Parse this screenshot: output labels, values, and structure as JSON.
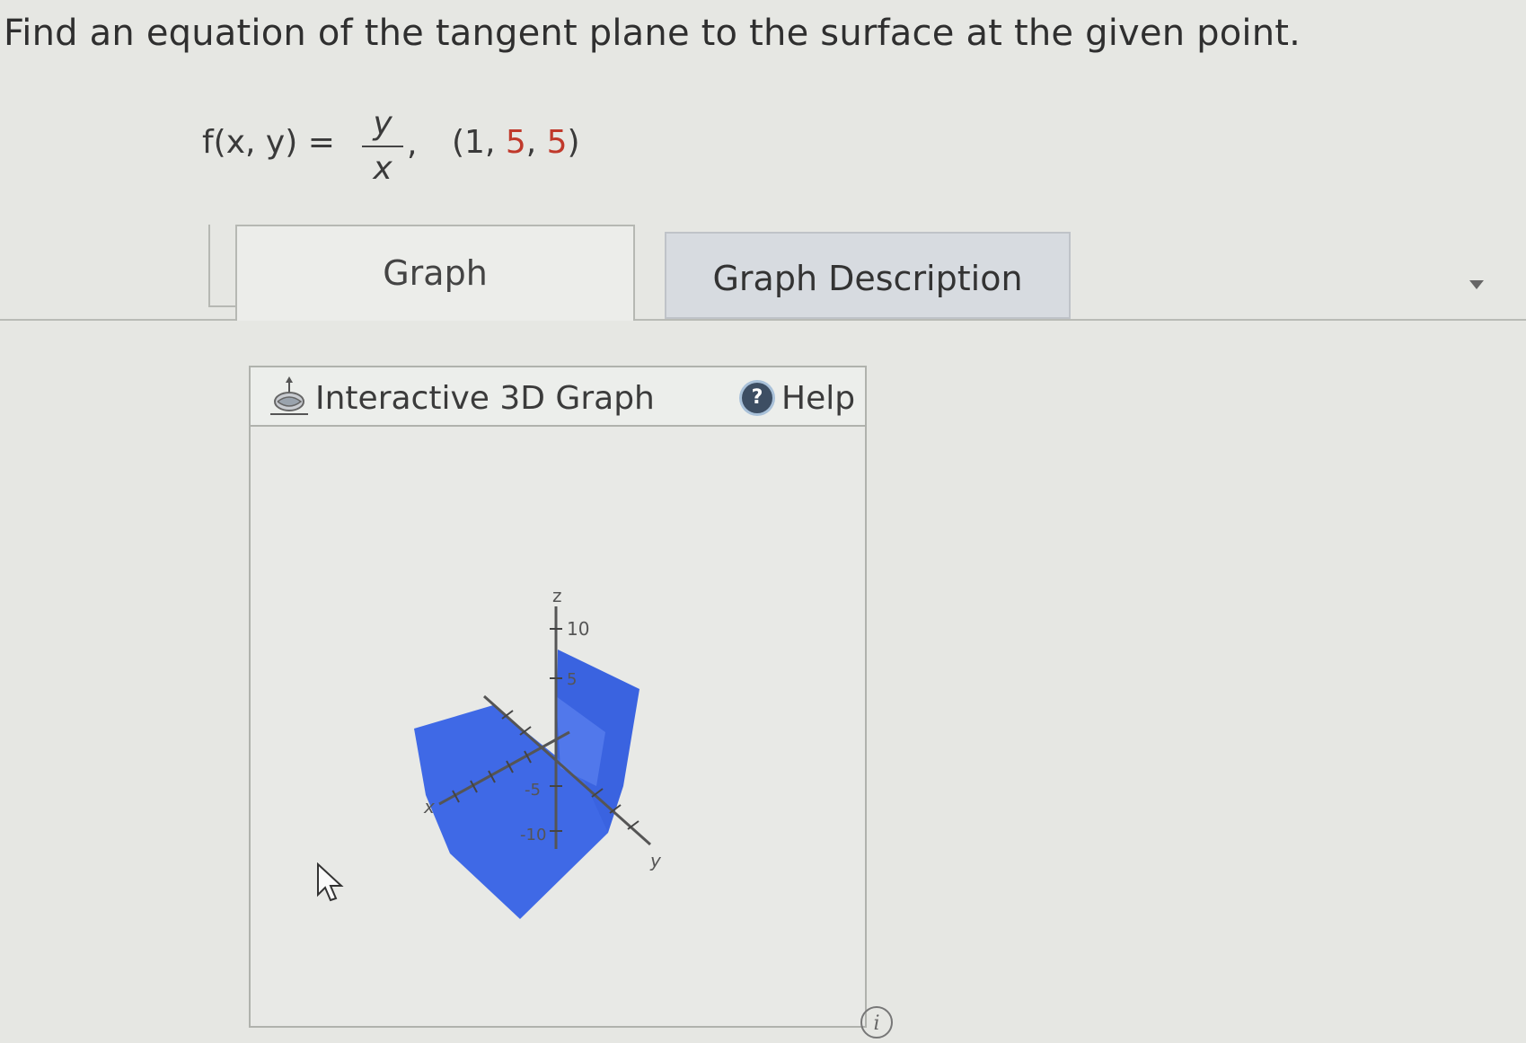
{
  "question": {
    "prompt": "Find an equation of the tangent plane to the surface at the given point."
  },
  "formula": {
    "lhs": "f(x, y) =",
    "numerator": "y",
    "denominator": "x",
    "comma": ",",
    "point_open": "(",
    "point_x": "1",
    "sep1": ", ",
    "point_y": "5",
    "sep2": ", ",
    "point_z": "5",
    "point_close": ")"
  },
  "tabs": [
    {
      "label": "Graph",
      "active": true
    },
    {
      "label": "Graph Description",
      "active": false
    }
  ],
  "panel": {
    "title": "Interactive 3D Graph",
    "help_label": "Help",
    "help_icon": "?"
  },
  "graph": {
    "axis_labels": {
      "x": "x",
      "y": "y",
      "z": "z"
    },
    "z_ticks": [
      "10",
      "5",
      "-5",
      "-10"
    ],
    "surface_color": "#3a63e0",
    "surface_color_light": "#5b82f0"
  },
  "info_icon": "i",
  "colors": {
    "accent_red": "#c0392b",
    "tab_inactive_bg": "#d7dbe0",
    "help_icon_bg": "#3d4e63"
  }
}
